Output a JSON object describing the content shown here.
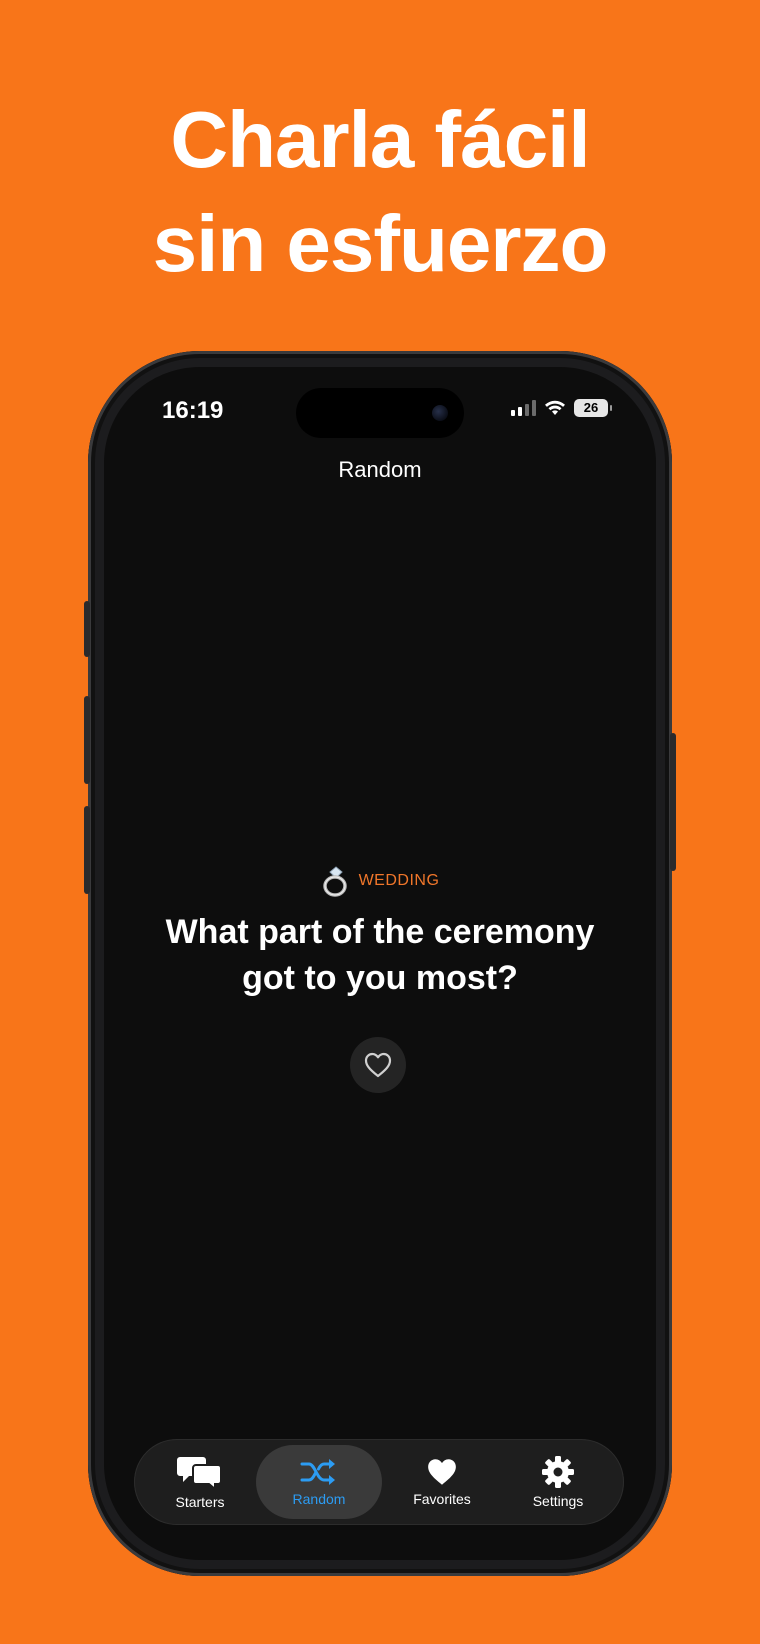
{
  "headline": {
    "line1": "Charla fácil",
    "line2": "sin esfuerzo"
  },
  "status_bar": {
    "time": "16:19",
    "battery": "26"
  },
  "screen": {
    "title": "Random",
    "category": {
      "emoji": "💍",
      "label": "WEDDING",
      "color": "#F0762A"
    },
    "question": "What part of the ceremony got to you most?",
    "favorite_icon": "heart-outline-icon"
  },
  "tabbar": {
    "tabs": [
      {
        "label": "Starters",
        "icon": "chat-bubbles-icon",
        "active": false
      },
      {
        "label": "Random",
        "icon": "shuffle-icon",
        "active": true
      },
      {
        "label": "Favorites",
        "icon": "heart-icon",
        "active": false
      },
      {
        "label": "Settings",
        "icon": "gear-icon",
        "active": false
      }
    ],
    "active_color": "#2C9CF3"
  },
  "colors": {
    "background": "#F87519",
    "screen": "#0D0D0D"
  }
}
